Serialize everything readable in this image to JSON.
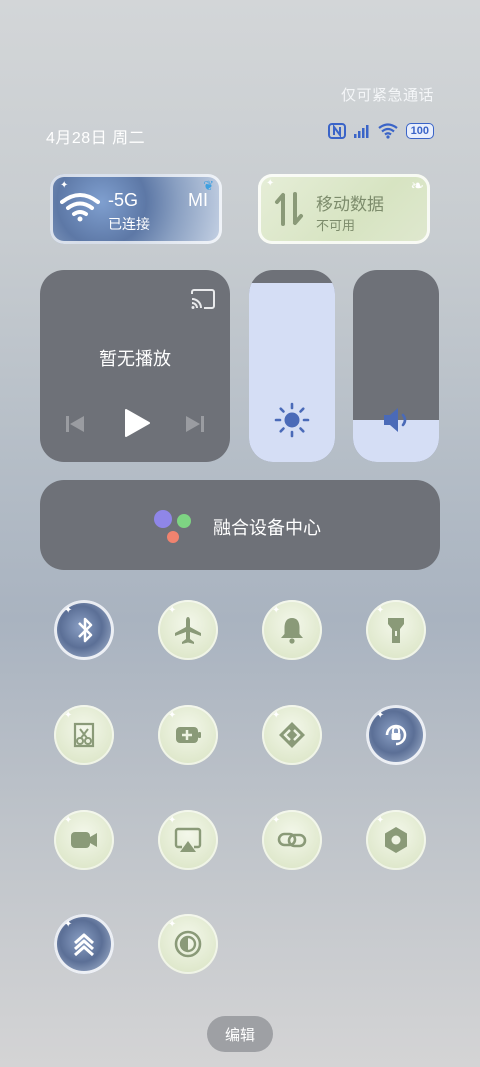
{
  "header": {
    "emergency_text": "仅可紧急通话",
    "date_text": "4月28日 周二",
    "battery_level": "100"
  },
  "tiles": {
    "wifi": {
      "ssid_left": "-5G",
      "ssid_right": "MI",
      "status": "已连接"
    },
    "mobile": {
      "title": "移动数据",
      "status": "不可用"
    }
  },
  "media": {
    "title": "暂无播放"
  },
  "sliders": {
    "brightness_level": 0.93,
    "volume_level": 0.22
  },
  "fusion": {
    "label": "融合设备中心"
  },
  "toggles": [
    {
      "icon": "bluetooth-icon",
      "state": "on"
    },
    {
      "icon": "airplane-icon",
      "state": "off"
    },
    {
      "icon": "bell-icon",
      "state": "off"
    },
    {
      "icon": "flashlight-icon",
      "state": "off"
    },
    {
      "icon": "screenshot-icon",
      "state": "off"
    },
    {
      "icon": "battery-saver-icon",
      "state": "off"
    },
    {
      "icon": "nearby-share-icon",
      "state": "off"
    },
    {
      "icon": "rotation-lock-icon",
      "state": "on"
    },
    {
      "icon": "screen-record-icon",
      "state": "off"
    },
    {
      "icon": "screen-cast-icon",
      "state": "off"
    },
    {
      "icon": "link-icon",
      "state": "off"
    },
    {
      "icon": "settings-hex-icon",
      "state": "off"
    },
    {
      "icon": "performance-mode-icon",
      "state": "on"
    },
    {
      "icon": "dark-mode-icon",
      "state": "off"
    }
  ],
  "edit_label": "编辑",
  "colors": {
    "tile_on_blue": "#5b6f96",
    "tile_off_green": "#dfe8cc",
    "icon_green": "#8a9a78",
    "panel_gray": "#6e7178",
    "slider_fill": "#d5def5",
    "battery_blue": "#3a64c8"
  }
}
